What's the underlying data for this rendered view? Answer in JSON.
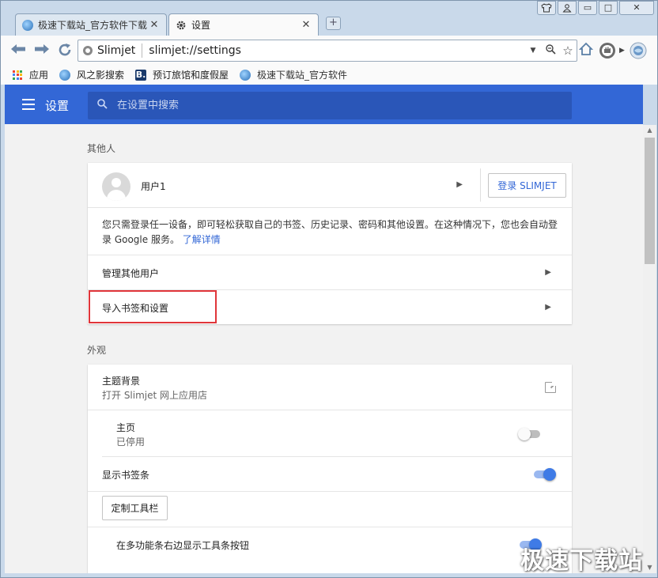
{
  "tabs": [
    {
      "title": "极速下载站_官方软件下载",
      "icon": "globe-favicon-icon",
      "close": "✕"
    },
    {
      "title": "设置",
      "icon": "gear-icon",
      "close": "✕"
    }
  ],
  "new_tab_glyph": "+",
  "window_controls": {
    "minimize": "▭",
    "maximize": "□",
    "close": "✕"
  },
  "toolbar": {
    "site_name": "Slimjet",
    "url": "slimjet://settings"
  },
  "bookmarks": [
    {
      "label": "应用",
      "icon": "apps-grid-icon"
    },
    {
      "label": "风之影搜索",
      "icon": "globe-icon"
    },
    {
      "label": "预订旅馆和度假屋",
      "icon": "booking-b-icon",
      "badge": "B."
    },
    {
      "label": "极速下载站_官方软件",
      "icon": "globe-icon"
    }
  ],
  "settings": {
    "title": "设置",
    "search_placeholder": "在设置中搜索"
  },
  "people": {
    "section_title": "其他人",
    "user_name": "用户1",
    "signin_label": "登录 SLIMJET",
    "description": "您只需登录任一设备，即可轻松获取自己的书签、历史记录、密码和其他设置。在这种情况下，您也会自动登录 Google 服务。",
    "learn_more": "了解详情",
    "manage_users": "管理其他用户",
    "import_bookmarks": "导入书签和设置"
  },
  "appearance": {
    "section_title": "外观",
    "theme_label": "主题背景",
    "theme_sub": "打开 Slimjet 网上应用店",
    "home_label": "主页",
    "home_sub": "已停用",
    "home_enabled": false,
    "bookmarks_bar_label": "显示书签条",
    "bookmarks_bar_enabled": true,
    "customize_toolbar": "定制工具栏",
    "toolbar_buttons_label": "在多功能条右边显示工具条按钮",
    "toolbar_buttons_enabled": true
  },
  "watermark": "极速下载站",
  "colors": {
    "header_blue": "#3367d6",
    "link_blue": "#3367d6",
    "highlight_red": "#e0353a"
  }
}
